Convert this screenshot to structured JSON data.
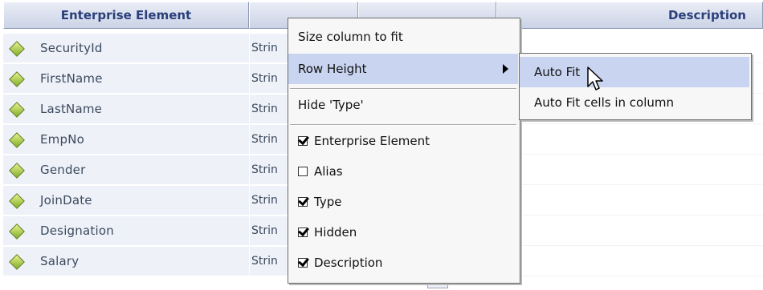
{
  "grid": {
    "columns": [
      {
        "id": "enterprise",
        "label": "Enterprise Element"
      },
      {
        "id": "type",
        "label": ""
      },
      {
        "id": "hidden",
        "label": ""
      },
      {
        "id": "description",
        "label": "Description"
      }
    ],
    "rows": [
      {
        "name": "SecurityId",
        "type": "Strin"
      },
      {
        "name": "FirstName",
        "type": "Strin"
      },
      {
        "name": "LastName",
        "type": "Strin"
      },
      {
        "name": "EmpNo",
        "type": "Strin"
      },
      {
        "name": "Gender",
        "type": "Strin"
      },
      {
        "name": "JoinDate",
        "type": "Strin"
      },
      {
        "name": "Designation",
        "type": "Strin"
      },
      {
        "name": "Salary",
        "type": "Strin"
      }
    ]
  },
  "context_menu": {
    "size_column": "Size column to fit",
    "row_height": "Row Height",
    "hide_type": "Hide 'Type'",
    "columns": [
      {
        "label": "Enterprise Element",
        "checked": true
      },
      {
        "label": "Alias",
        "checked": false
      },
      {
        "label": "Type",
        "checked": true
      },
      {
        "label": "Hidden",
        "checked": true
      },
      {
        "label": "Description",
        "checked": true
      }
    ]
  },
  "submenu": {
    "auto_fit": "Auto Fit",
    "auto_fit_cells": "Auto Fit cells in column"
  },
  "colors": {
    "header_text": "#2b3f7a",
    "row_bg": "#eef1f8",
    "menu_highlight": "#c9d4f0",
    "diamond": "#9bc03a"
  }
}
